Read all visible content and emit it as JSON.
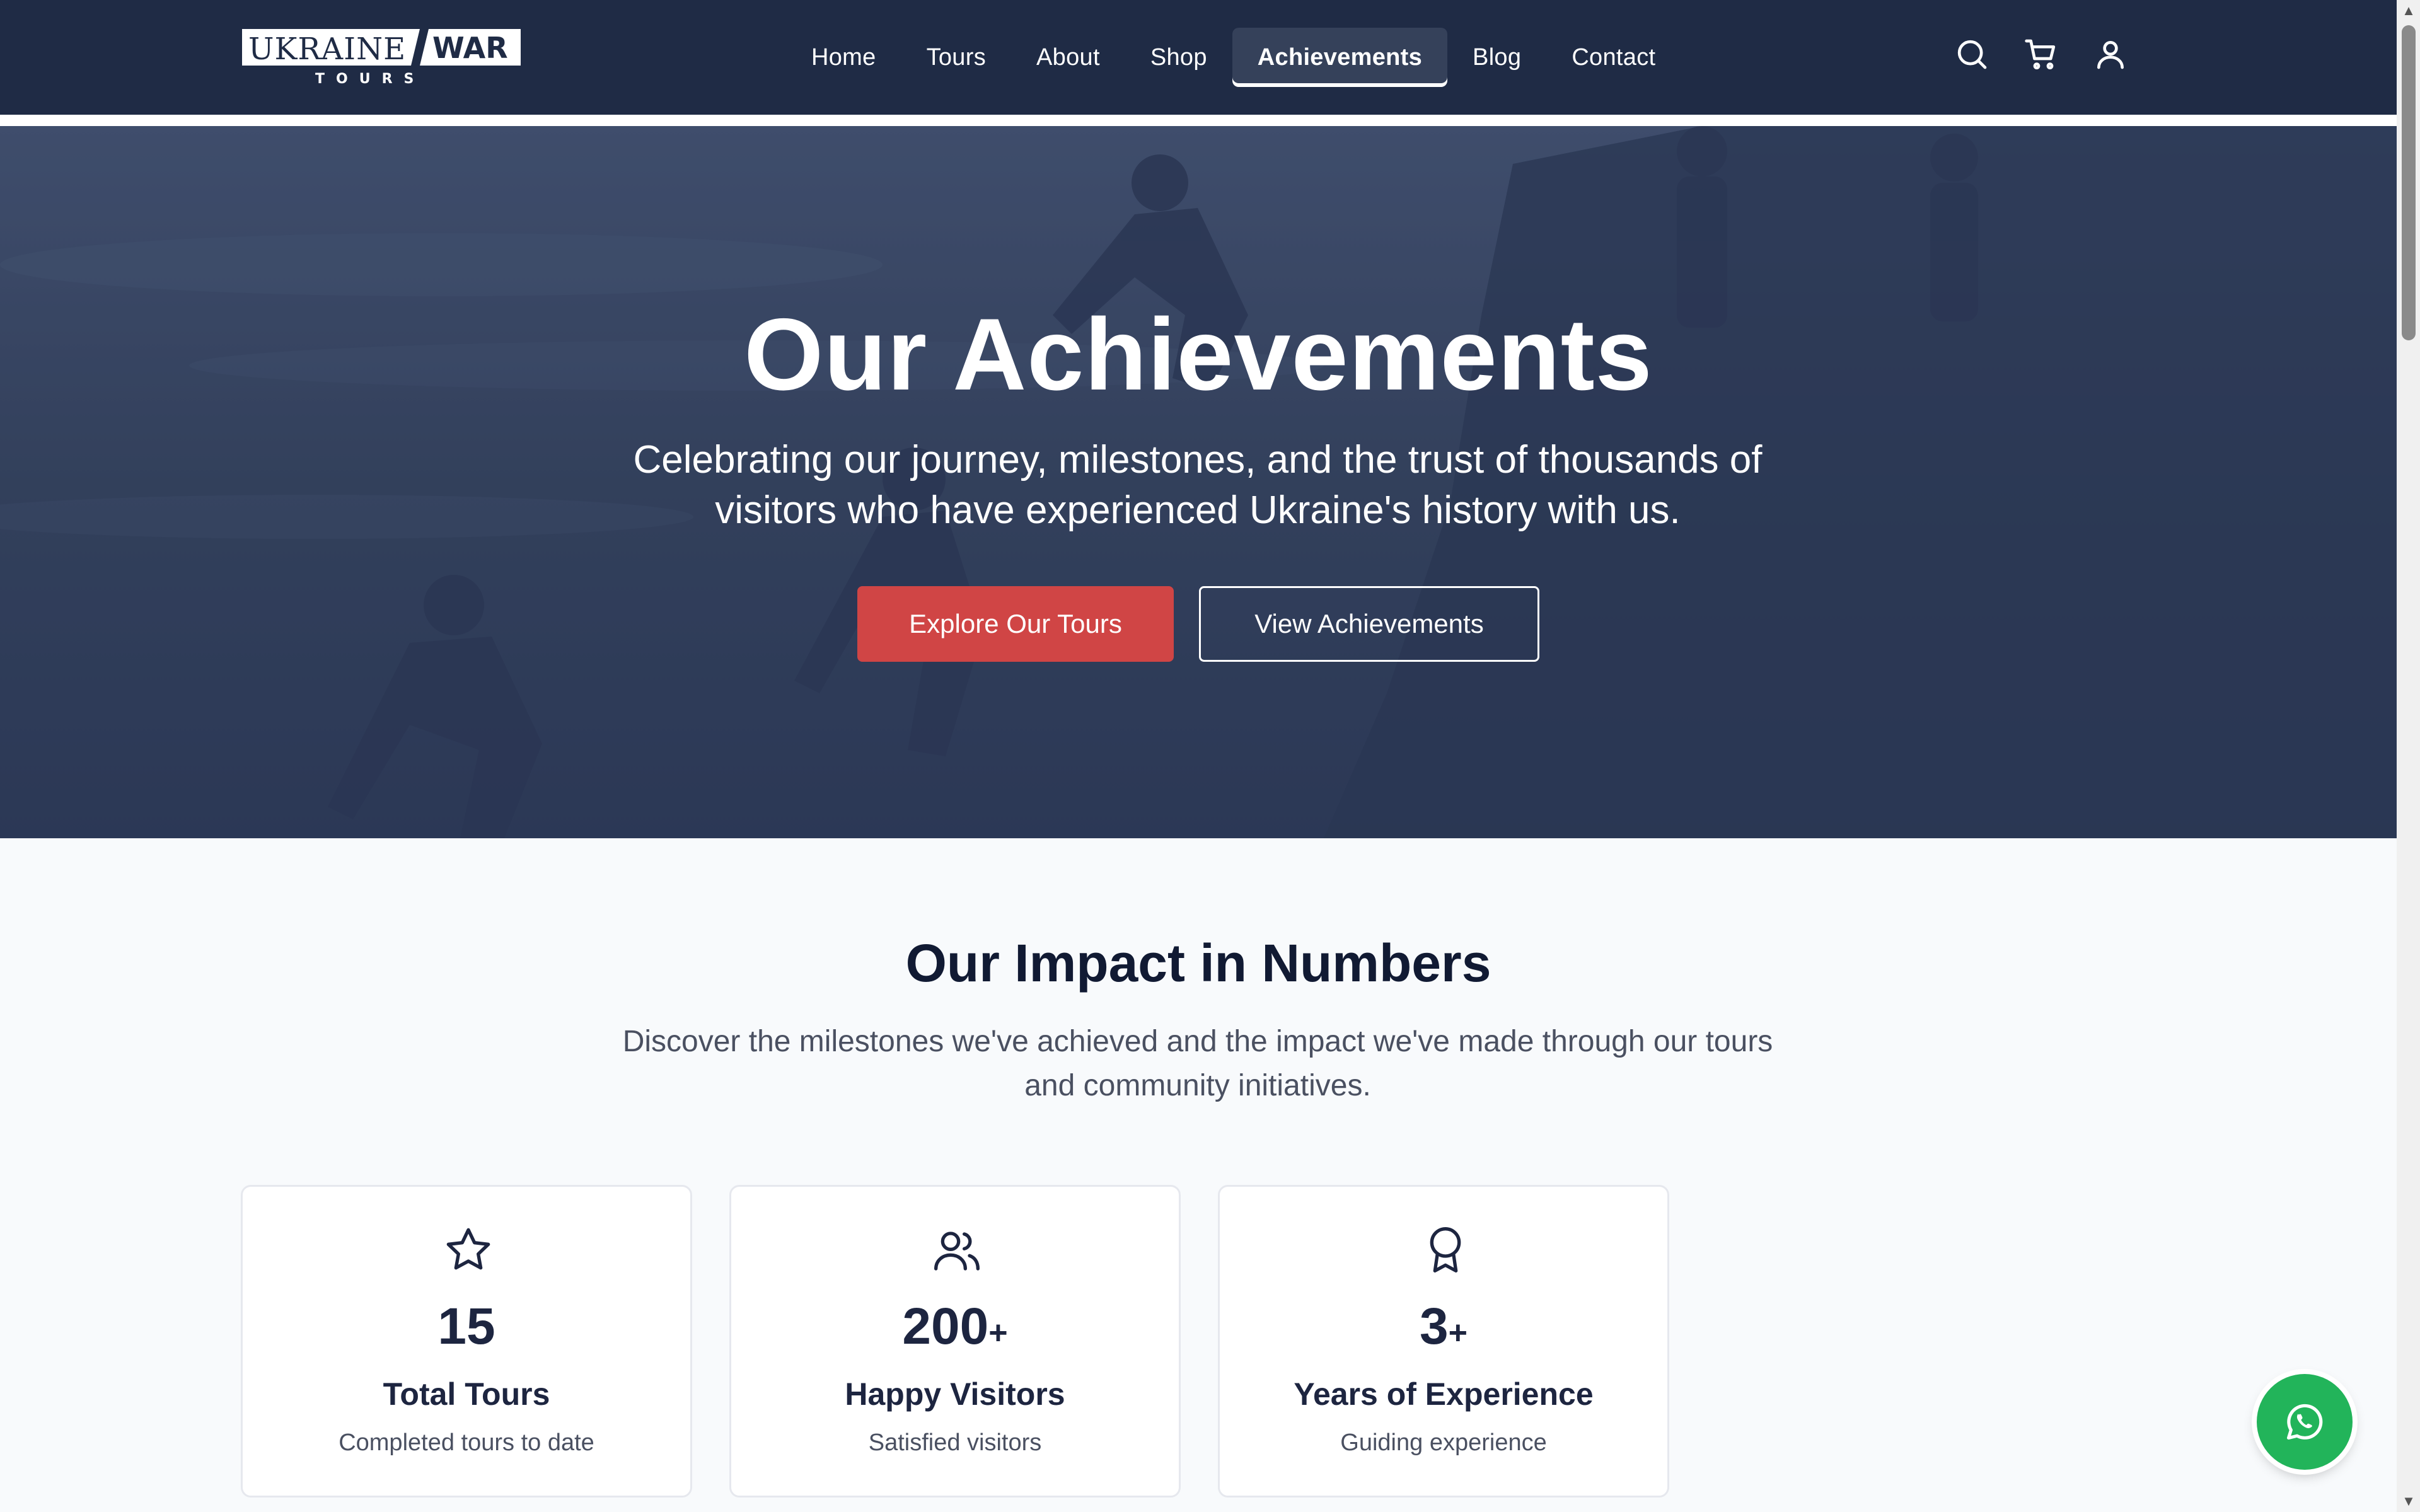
{
  "brand": {
    "logo_left": "UKRAINE",
    "logo_right": "WAR",
    "logo_sub": "T O U R S"
  },
  "nav": {
    "items": [
      {
        "label": "Home"
      },
      {
        "label": "Tours"
      },
      {
        "label": "About"
      },
      {
        "label": "Shop"
      },
      {
        "label": "Achievements",
        "active": true
      },
      {
        "label": "Blog"
      },
      {
        "label": "Contact"
      }
    ]
  },
  "header_icons": [
    "search-icon",
    "cart-icon",
    "user-icon"
  ],
  "hero": {
    "title": "Our Achievements",
    "subtitle": "Celebrating our journey, milestones, and the trust of thousands of visitors who have experienced Ukraine's history with us.",
    "primary_button": "Explore Our Tours",
    "secondary_button": "View Achievements"
  },
  "impact": {
    "title": "Our Impact in Numbers",
    "subtitle": "Discover the milestones we've achieved and the impact we've made through our tours and community initiatives.",
    "stats": [
      {
        "icon": "star-icon",
        "value": "15",
        "suffix": "",
        "label": "Total Tours",
        "desc": "Completed tours to date"
      },
      {
        "icon": "users-icon",
        "value": "200",
        "suffix": "+",
        "label": "Happy Visitors",
        "desc": "Satisfied visitors"
      },
      {
        "icon": "award-icon",
        "value": "3",
        "suffix": "+",
        "label": "Years of Experience",
        "desc": "Guiding experience"
      }
    ]
  },
  "colors": {
    "header_bg": "#1f2b45",
    "hero_bg": "#2f3c5a",
    "primary": "#d04545",
    "text_dark": "#111a33",
    "whatsapp": "#22b45a"
  },
  "floating": {
    "icon": "whatsapp-icon"
  }
}
